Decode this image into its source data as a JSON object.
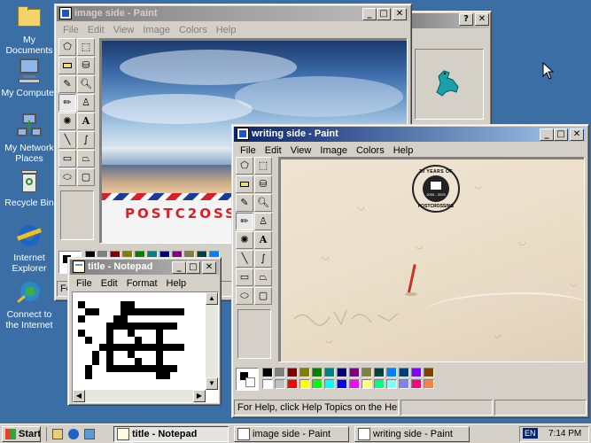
{
  "desktop": {
    "icons": [
      {
        "label": "My Documents"
      },
      {
        "label": "My Computer"
      },
      {
        "label": "My Network Places"
      },
      {
        "label": "Recycle Bin"
      },
      {
        "label": "Internet Explorer"
      },
      {
        "label": "Connect to the Internet"
      }
    ]
  },
  "dialog_back": {
    "help_label": "?",
    "close_label": "✕"
  },
  "paint_image": {
    "title": "image side - Paint",
    "menu": [
      "File",
      "Edit",
      "View",
      "Image",
      "Colors",
      "Help"
    ],
    "postcard_text": "POSTC2OSS",
    "status_fragment": "For"
  },
  "paint_writing": {
    "title": "writing side - Paint",
    "menu": [
      "File",
      "Edit",
      "View",
      "Image",
      "Colors",
      "Help"
    ],
    "stamp_top": "20 YEARS OF",
    "stamp_bottom": "POSTCROSSING",
    "stamp_years": "2005 - 2025",
    "status": "For Help, click Help Topics on the Help Menu."
  },
  "notepad": {
    "title": "title - Notepad",
    "menu": [
      "File",
      "Edit",
      "Format",
      "Help"
    ]
  },
  "taskbar": {
    "start": "Start",
    "tasks": [
      "title - Notepad",
      "image side - Paint",
      "writing side - Paint"
    ],
    "lang": "EN",
    "clock": "7:14 PM"
  },
  "colors": {
    "palette": [
      "#000000",
      "#808080",
      "#800000",
      "#808000",
      "#008000",
      "#008080",
      "#000080",
      "#800080",
      "#808040",
      "#004040",
      "#0080ff",
      "#004080",
      "#8000ff",
      "#804000",
      "#ffffff",
      "#c0c0c0",
      "#ff0000",
      "#ffff00",
      "#00ff00",
      "#00ffff",
      "#0000ff",
      "#ff00ff",
      "#ffff80",
      "#00ff80",
      "#80ffff",
      "#8080ff",
      "#ff0080",
      "#ff8040"
    ]
  }
}
